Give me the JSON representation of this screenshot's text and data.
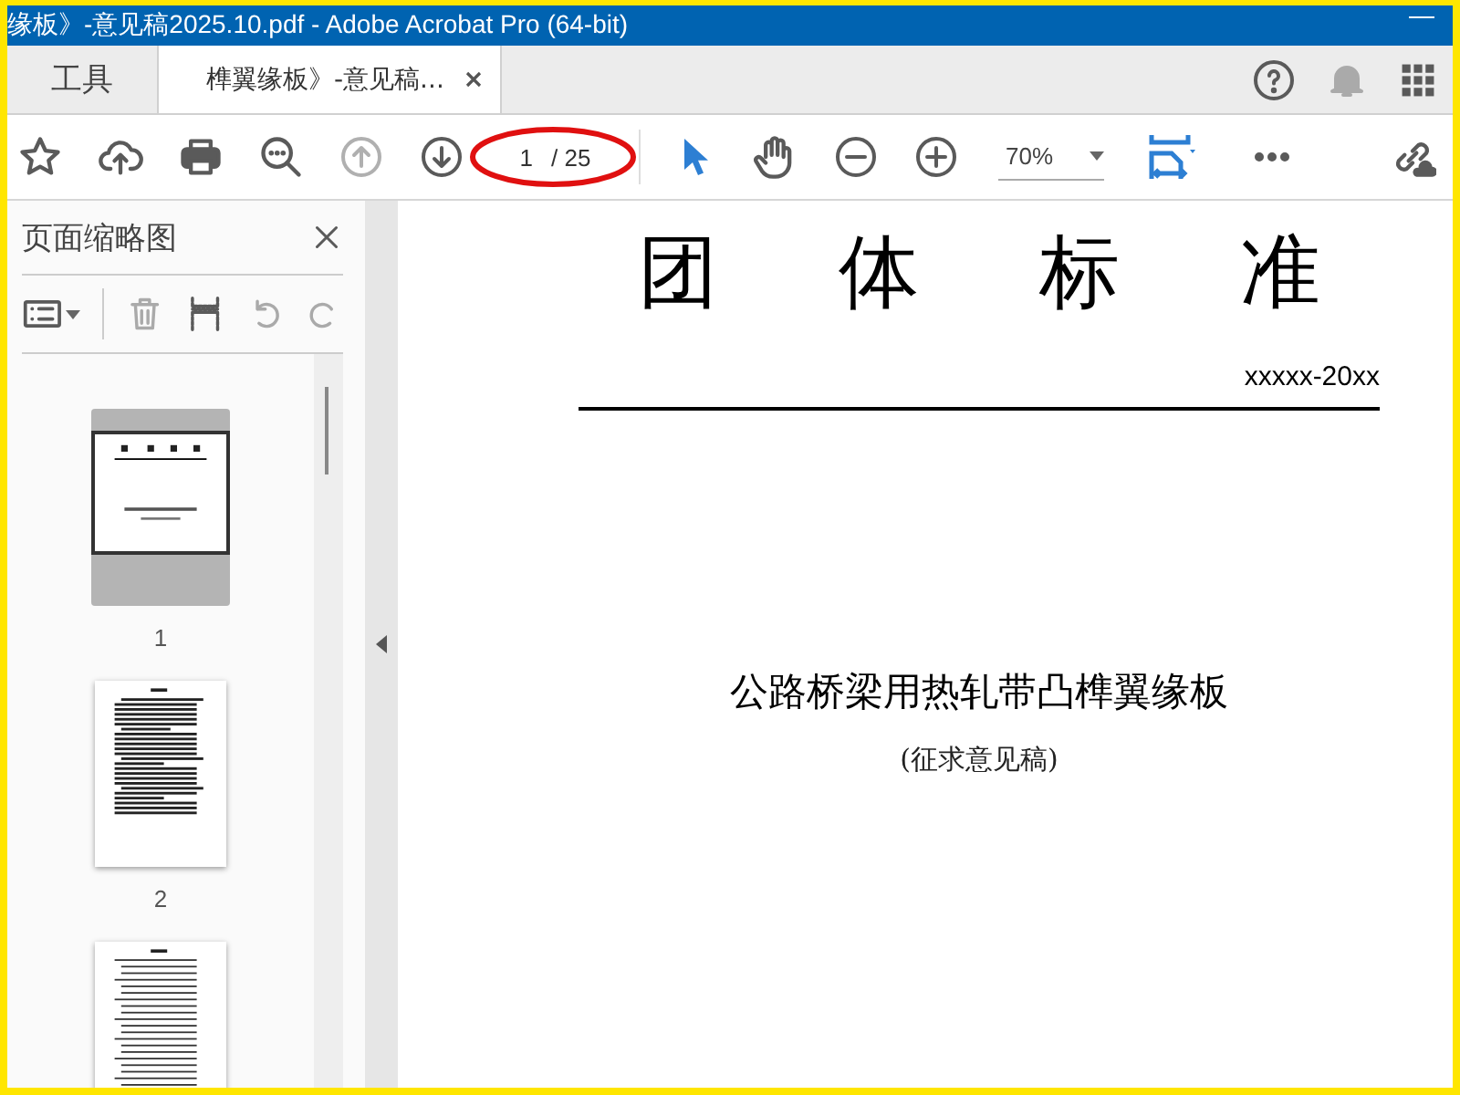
{
  "window": {
    "title": "缘板》-意见稿2025.10.pdf - Adobe Acrobat Pro (64-bit)"
  },
  "tabs": [
    {
      "label": "工具",
      "selected": false
    },
    {
      "label": "榫翼缘板》-意见稿...",
      "selected": true,
      "closable": true
    }
  ],
  "toolbar": {
    "page_field": {
      "value": "1"
    },
    "page_total": "/ 25",
    "zoom_field": {
      "value": "70%"
    },
    "previous_page_disabled": true
  },
  "sidebar": {
    "title": "页面缩略图",
    "thumbnails": [
      {
        "label": "1",
        "selected": true,
        "kind": "cover"
      },
      {
        "label": "2",
        "selected": false,
        "kind": "text"
      },
      {
        "selected": false,
        "kind": "contents"
      }
    ]
  },
  "document": {
    "heading": "团体标准",
    "code": "xxxxx-20xx",
    "title": "公路桥梁用热轧带凸榫翼缘板",
    "subtitle": "(征求意见稿)"
  }
}
